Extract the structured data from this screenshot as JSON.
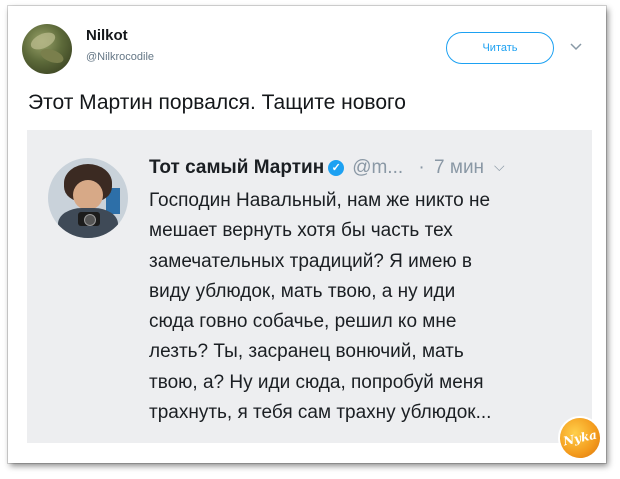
{
  "tweet": {
    "author_name": "Nilkot",
    "author_handle": "@Nilkrocodile",
    "follow_label": "Читать",
    "text": "Этот Мартин порвался. Тащите нового"
  },
  "screenshot": {
    "name": "Тот самый Мартин",
    "verified_icon": "check-badge-icon",
    "handle": "@m...",
    "time_sep": "·",
    "time": "7 мин",
    "body_lines": [
      "Господин Навальный, нам же никто не",
      "мешает вернуть хотя бы часть тех",
      "замечательных традиций? Я имею в",
      "виду ублюдок, мать твою, а ну иди",
      "сюда говно собачье, решил ко мне",
      "лезть? Ты, засранец вонючий, мать",
      "твою, а? Ну иди сюда, попробуй меня",
      "трахнуть, я тебя сам трахну ублюдок..."
    ]
  },
  "watermark": {
    "text": "Nyka"
  },
  "colors": {
    "accent": "#1da1f2",
    "screenshot_bg": "#edeef0",
    "muted": "#657786"
  }
}
